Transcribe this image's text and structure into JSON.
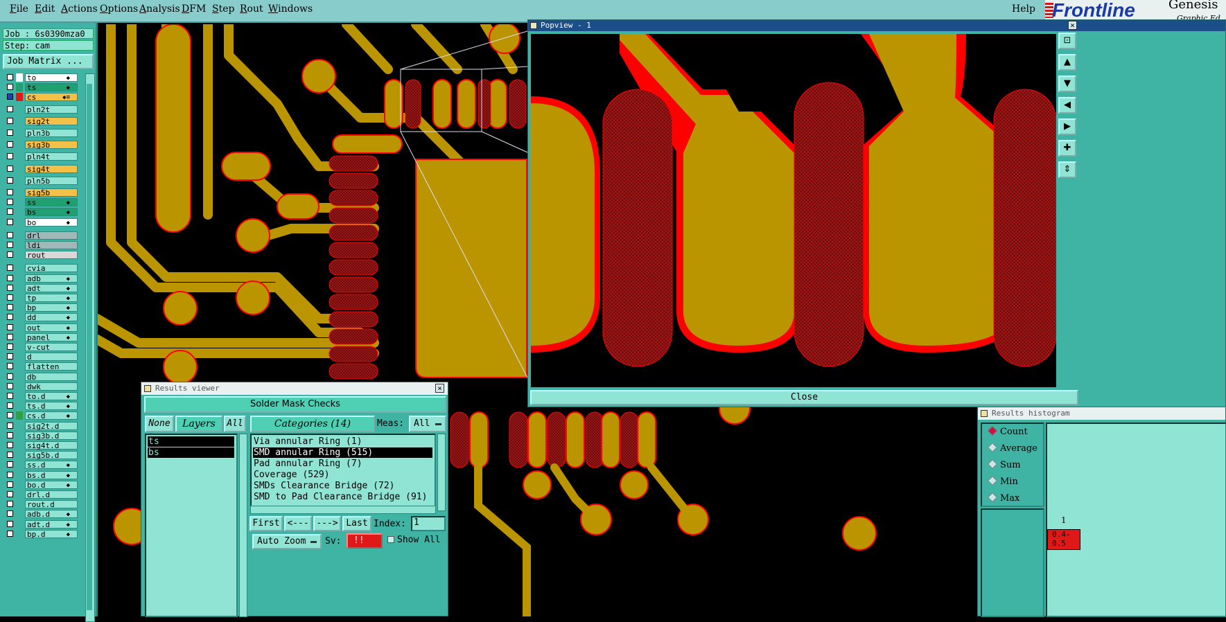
{
  "menu": {
    "items": [
      "File",
      "Edit",
      "Actions",
      "Options",
      "Analysis",
      "DFM",
      "Step",
      "Rout",
      "Windows"
    ],
    "help": "Help"
  },
  "logo": {
    "brand": "Frontline",
    "product": "Genesis",
    "sub": "Graphic Ed"
  },
  "job": {
    "job_line": "Job : 6s0390mza0",
    "step_line": "Step: cam",
    "matrix_button": "Job Matrix ..."
  },
  "layers": [
    {
      "name": "to",
      "color": "#ffffff",
      "mark": "#ffffff",
      "st": "◆"
    },
    {
      "name": "ts",
      "color": "#20a070",
      "mark": "#20a070",
      "st": "◆"
    },
    {
      "name": "cs",
      "color": "#f4c048",
      "mark": "#e01818",
      "st": "◆≡",
      "sel": true
    },
    {
      "name": "pln2t",
      "color": "#8fe4d4",
      "mark": "",
      "st": ""
    },
    {
      "name": "sig2t",
      "color": "#f4c048",
      "mark": "",
      "st": ""
    },
    {
      "name": "pln3b",
      "color": "#8fe4d4",
      "mark": "",
      "st": ""
    },
    {
      "name": "sig3b",
      "color": "#f4c048",
      "mark": "",
      "st": ""
    },
    {
      "name": "pln4t",
      "color": "#8fe4d4",
      "mark": "",
      "st": ""
    },
    {
      "name": "sig4t",
      "color": "#f4c048",
      "mark": "",
      "st": ""
    },
    {
      "name": "pln5b",
      "color": "#8fe4d4",
      "mark": "",
      "st": ""
    },
    {
      "name": "sig5b",
      "color": "#f4c048",
      "mark": "",
      "st": ""
    },
    {
      "name": "ss",
      "color": "#20a070",
      "mark": "",
      "st": "◆"
    },
    {
      "name": "bs",
      "color": "#20a070",
      "mark": "",
      "st": "◆"
    },
    {
      "name": "bo",
      "color": "#ffffff",
      "mark": "",
      "st": "◆"
    },
    {
      "name": "drl",
      "color": "#a0b8b8",
      "mark": "",
      "st": ""
    },
    {
      "name": "ldi",
      "color": "#a0b8b8",
      "mark": "",
      "st": ""
    },
    {
      "name": "rout",
      "color": "#d8d8d8",
      "mark": "",
      "st": ""
    },
    {
      "name": "cvia",
      "color": "#8fe4d4",
      "mark": "",
      "st": ""
    },
    {
      "name": "adb",
      "color": "#8fe4d4",
      "mark": "",
      "st": "◆"
    },
    {
      "name": "adt",
      "color": "#8fe4d4",
      "mark": "",
      "st": "◆"
    },
    {
      "name": "tp",
      "color": "#8fe4d4",
      "mark": "",
      "st": "◆"
    },
    {
      "name": "bp",
      "color": "#8fe4d4",
      "mark": "",
      "st": "◆"
    },
    {
      "name": "dd",
      "color": "#8fe4d4",
      "mark": "",
      "st": "◆"
    },
    {
      "name": "out",
      "color": "#8fe4d4",
      "mark": "",
      "st": "◆"
    },
    {
      "name": "panel",
      "color": "#8fe4d4",
      "mark": "",
      "st": "◆"
    },
    {
      "name": "v-cut",
      "color": "#8fe4d4",
      "mark": "",
      "st": ""
    },
    {
      "name": "d",
      "color": "#8fe4d4",
      "mark": "",
      "st": ""
    },
    {
      "name": "flatten",
      "color": "#8fe4d4",
      "mark": "",
      "st": ""
    },
    {
      "name": "db",
      "color": "#8fe4d4",
      "mark": "",
      "st": ""
    },
    {
      "name": "dwk",
      "color": "#8fe4d4",
      "mark": "",
      "st": ""
    },
    {
      "name": "to.d",
      "color": "#8fe4d4",
      "mark": "",
      "st": "◆"
    },
    {
      "name": "ts.d",
      "color": "#8fe4d4",
      "mark": "",
      "st": "◆"
    },
    {
      "name": "cs.d",
      "color": "#8fe4d4",
      "mark": "#30a040",
      "st": "◆"
    },
    {
      "name": "sig2t.d",
      "color": "#8fe4d4",
      "mark": "",
      "st": ""
    },
    {
      "name": "sig3b.d",
      "color": "#8fe4d4",
      "mark": "",
      "st": ""
    },
    {
      "name": "sig4t.d",
      "color": "#8fe4d4",
      "mark": "",
      "st": ""
    },
    {
      "name": "sig5b.d",
      "color": "#8fe4d4",
      "mark": "",
      "st": ""
    },
    {
      "name": "ss.d",
      "color": "#8fe4d4",
      "mark": "",
      "st": "◆"
    },
    {
      "name": "bs.d",
      "color": "#8fe4d4",
      "mark": "",
      "st": "◆"
    },
    {
      "name": "bo.d",
      "color": "#8fe4d4",
      "mark": "",
      "st": "◆"
    },
    {
      "name": "drl.d",
      "color": "#8fe4d4",
      "mark": "",
      "st": ""
    },
    {
      "name": "rout.d",
      "color": "#8fe4d4",
      "mark": "",
      "st": ""
    },
    {
      "name": "adb.d",
      "color": "#8fe4d4",
      "mark": "",
      "st": "◆"
    },
    {
      "name": "adt.d",
      "color": "#8fe4d4",
      "mark": "",
      "st": "◆"
    },
    {
      "name": "bp.d",
      "color": "#8fe4d4",
      "mark": "",
      "st": "◆"
    }
  ],
  "popview": {
    "title": "Popview - 1",
    "close_label": "Close"
  },
  "results_viewer": {
    "title": "Results viewer",
    "header": "Solder Mask Checks",
    "none_label": "None",
    "layers_label": "Layers",
    "all_label": "All",
    "layer_items": [
      "ts",
      "bs"
    ],
    "categories_label": "Categories (14)",
    "meas_label": "Meas:",
    "meas_value": "All",
    "categories": [
      "Via annular Ring (1)",
      "SMD annular Ring (515)",
      "Pad annular Ring (7)",
      "Coverage (529)",
      "SMDs Clearance Bridge (72)",
      "SMD to Pad Clearance Bridge (91)"
    ],
    "selected_category": 1,
    "first_label": "First",
    "prev_label": "<---",
    "next_label": "--->",
    "last_label": "Last",
    "index_label": "Index:",
    "index_value": "1",
    "auto_zoom_label": "Auto Zoom",
    "sv_label": "Sv:",
    "sv_value": "!!",
    "show_all_label": "Show All"
  },
  "histogram": {
    "title": "Results histogram",
    "options": [
      "Count",
      "Average",
      "Sum",
      "Min",
      "Max"
    ],
    "selected": "Count",
    "bar_count": "1",
    "bin_label_1": "0.4-",
    "bin_label_2": "0.5"
  },
  "colors": {
    "copper": "#bb9500",
    "mask": "#7a0e0e",
    "outline": "#ff0000",
    "panel": "#3fb4a4"
  }
}
